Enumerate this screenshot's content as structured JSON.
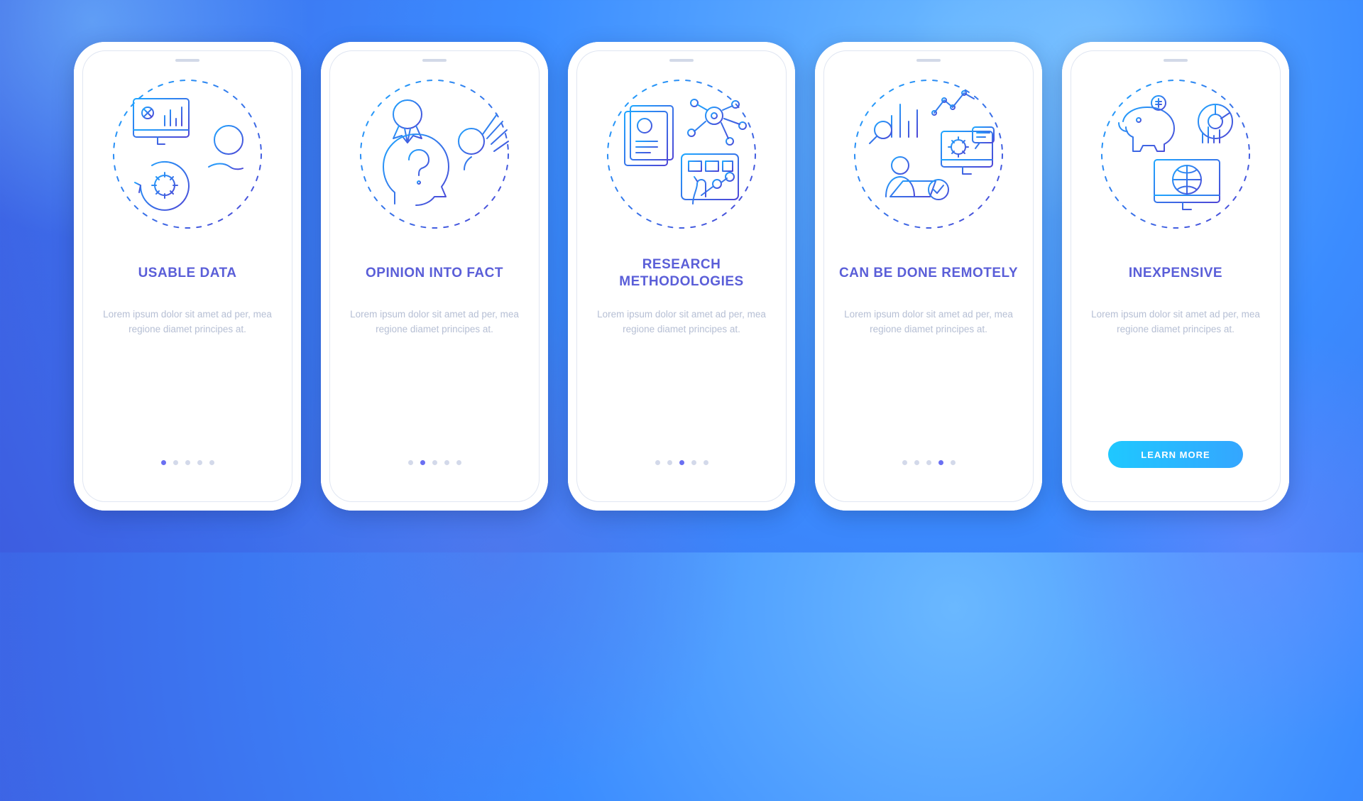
{
  "cta_label": "LEARN MORE",
  "body_text": "Lorem ipsum dolor sit amet ad per, mea regione diamet principes at.",
  "icons": [
    "usable-data-icon",
    "opinion-into-fact-icon",
    "research-methodologies-icon",
    "remote-work-icon",
    "inexpensive-icon"
  ],
  "screens": [
    {
      "title": "USABLE DATA"
    },
    {
      "title": "OPINION INTO FACT"
    },
    {
      "title": "RESEARCH METHODOLOGIES"
    },
    {
      "title": "CAN BE DONE REMOTELY"
    },
    {
      "title": "INEXPENSIVE"
    }
  ],
  "colors": {
    "title": "#5a5ed8",
    "body": "#b6bfd4",
    "dot": "#d3d9ea",
    "dot_active": "#6a6ff2",
    "cta_start": "#1fc8ff",
    "cta_end": "#34a6ff",
    "icon_grad_start": "#1ea6ff",
    "icon_grad_end": "#4e46d6"
  }
}
